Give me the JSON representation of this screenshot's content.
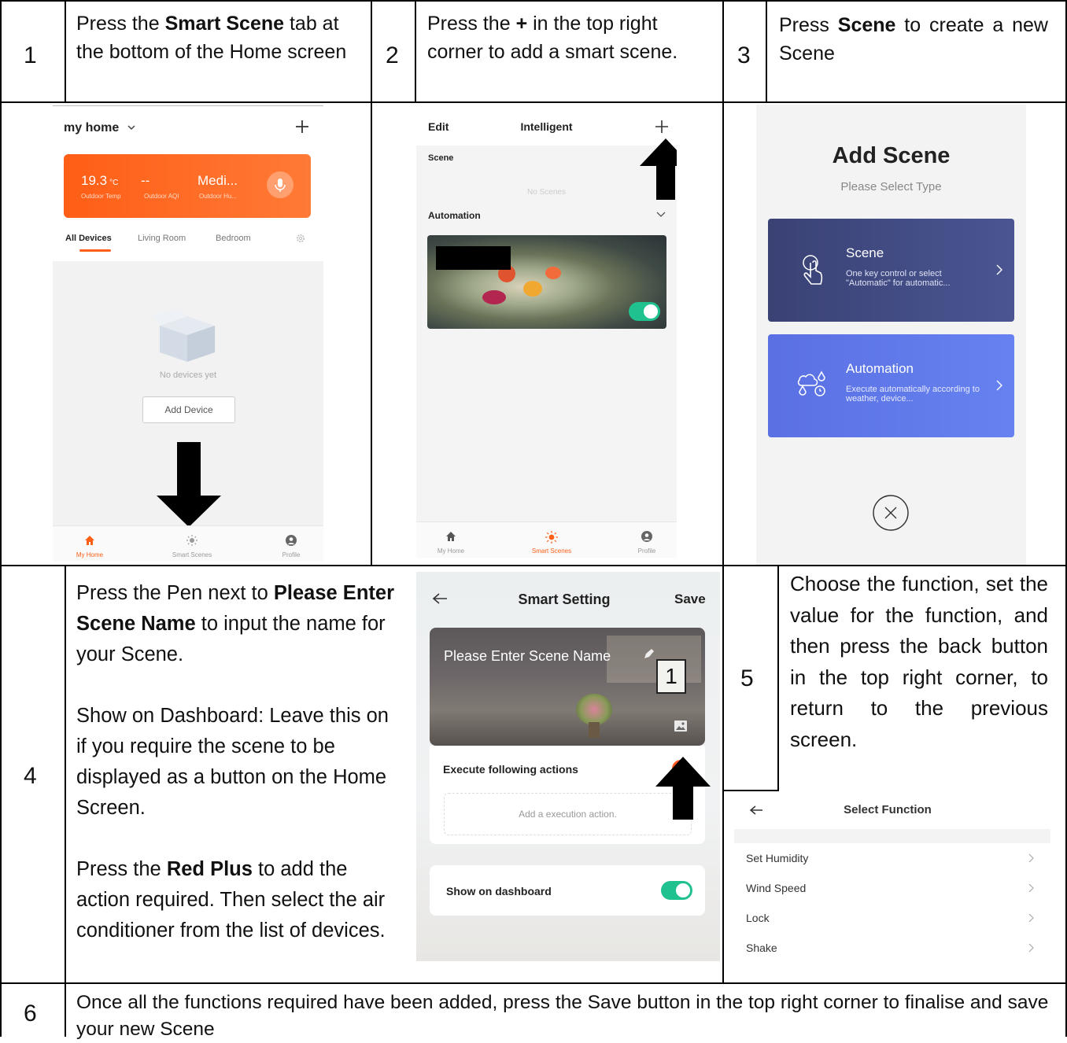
{
  "steps": {
    "s1": {
      "num": "1",
      "pre": "Press the ",
      "bold": "Smart Scene",
      "post": " tab at the bottom of the Home screen"
    },
    "s2": {
      "num": "2",
      "pre": "Press the ",
      "bold": "+",
      "post": " in the top right corner to add a smart scene."
    },
    "s3": {
      "num": "3",
      "pre": "Press ",
      "bold": "Scene",
      "post": " to create a new Scene"
    },
    "s4": {
      "num": "4",
      "p1_pre": "Press the Pen next to ",
      "p1_bold": "Please Enter Scene Name",
      "p1_post": " to input the name for your Scene.",
      "p2": "Show on Dashboard: Leave this on if you require the scene to be displayed as a button on the Home Screen.",
      "p3_pre": "Press the ",
      "p3_bold": "Red Plus",
      "p3_post": " to add the action required.  Then select the air conditioner from the list of devices."
    },
    "s5": {
      "num": "5",
      "text": "Choose the function, set the value for the function, and then press the back button in the top right corner, to return to the previous screen."
    },
    "s6": {
      "num": "6",
      "text": "Once all the functions required have been added, press the Save button in the top right corner to finalise and save your new Scene"
    }
  },
  "screen1": {
    "home_name": "my home",
    "add_icon": "plus-icon",
    "temp_value": "19.3",
    "temp_unit": "°C",
    "temp_label": "Outdoor Temp",
    "aqi_value": "--",
    "aqi_label": "Outdoor AQI",
    "hum_value": "Medi...",
    "hum_label": "Outdoor Hu...",
    "tabs": [
      "All Devices",
      "Living Room",
      "Bedroom"
    ],
    "empty_text": "No devices yet",
    "add_device": "Add Device",
    "nav": [
      "My Home",
      "Smart Scenes",
      "Profile"
    ],
    "accent": "#ff5e16"
  },
  "screen2": {
    "edit": "Edit",
    "title": "Intelligent",
    "scene_label": "Scene",
    "no_scenes": "No Scenes",
    "automation_label": "Automation",
    "nav": [
      "My Home",
      "Smart Scenes",
      "Profile"
    ]
  },
  "screen3": {
    "title": "Add Scene",
    "subtitle": "Please Select Type",
    "card1_title": "Scene",
    "card1_desc": "One key control or select \"Automatic\" for automatic...",
    "card2_title": "Automation",
    "card2_desc": "Execute automatically according to weather, device...",
    "card1_color": "#3f4a7f",
    "card2_color": "#5570e8"
  },
  "screen4": {
    "title": "Smart Setting",
    "save": "Save",
    "scene_name_placeholder": "Please Enter Scene Name",
    "execute_label": "Execute following actions",
    "add_action": "Add a execution action.",
    "dashboard_label": "Show on dashboard",
    "photo_number": "1"
  },
  "screen5": {
    "title": "Select Function",
    "functions": [
      "Set Humidity",
      "Wind Speed",
      "Lock",
      "Shake"
    ]
  }
}
